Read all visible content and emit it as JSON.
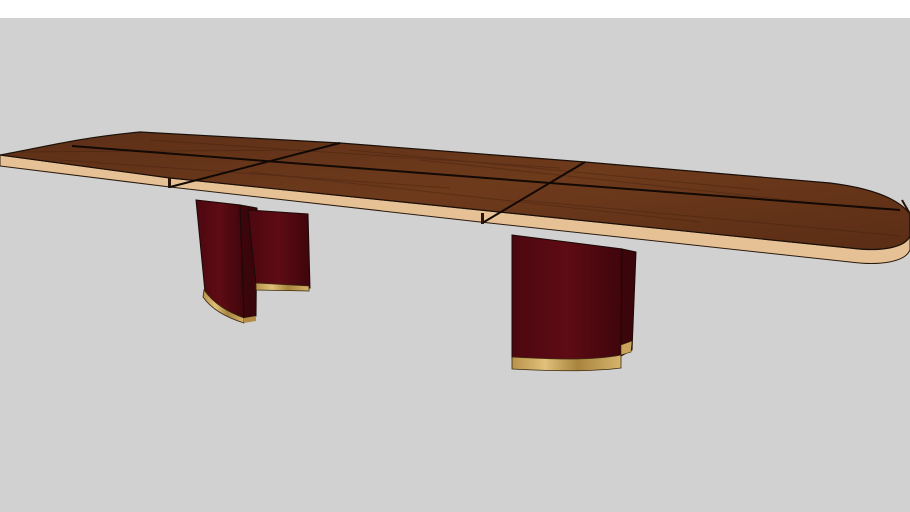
{
  "scene": {
    "background_color": "#d1d1d1",
    "top_band_color": "#ffffff",
    "object": "conference-table",
    "colors": {
      "wood_dark": "#4a2412",
      "wood_mid": "#6b3a1e",
      "wood_light": "#7d4524",
      "edge_trim": "#e8c49a",
      "pedestal": "#5a0a10",
      "pedestal_shadow": "#3d0609",
      "gold_base": "#c9a45a",
      "outline": "#1a0f08"
    }
  }
}
